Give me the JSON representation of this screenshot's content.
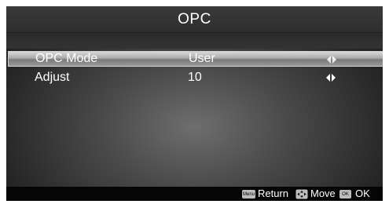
{
  "menu": {
    "title": "OPC",
    "rows": [
      {
        "label": "OPC Mode",
        "value": "User",
        "selected": true
      },
      {
        "label": "Adjust",
        "value": "10",
        "selected": false
      }
    ]
  },
  "footer": {
    "menu_key": "Menu",
    "return_label": "Return",
    "move_label": "Move",
    "ok_key": "OK",
    "ok_label": "OK"
  },
  "icons": {
    "row_arrows": "left-right-arrows-icon",
    "move_key": "dpad-icon"
  },
  "colors": {
    "selection_highlight": "#b0b0b0",
    "text": "#ffffff",
    "footer_bg": "#050505"
  }
}
